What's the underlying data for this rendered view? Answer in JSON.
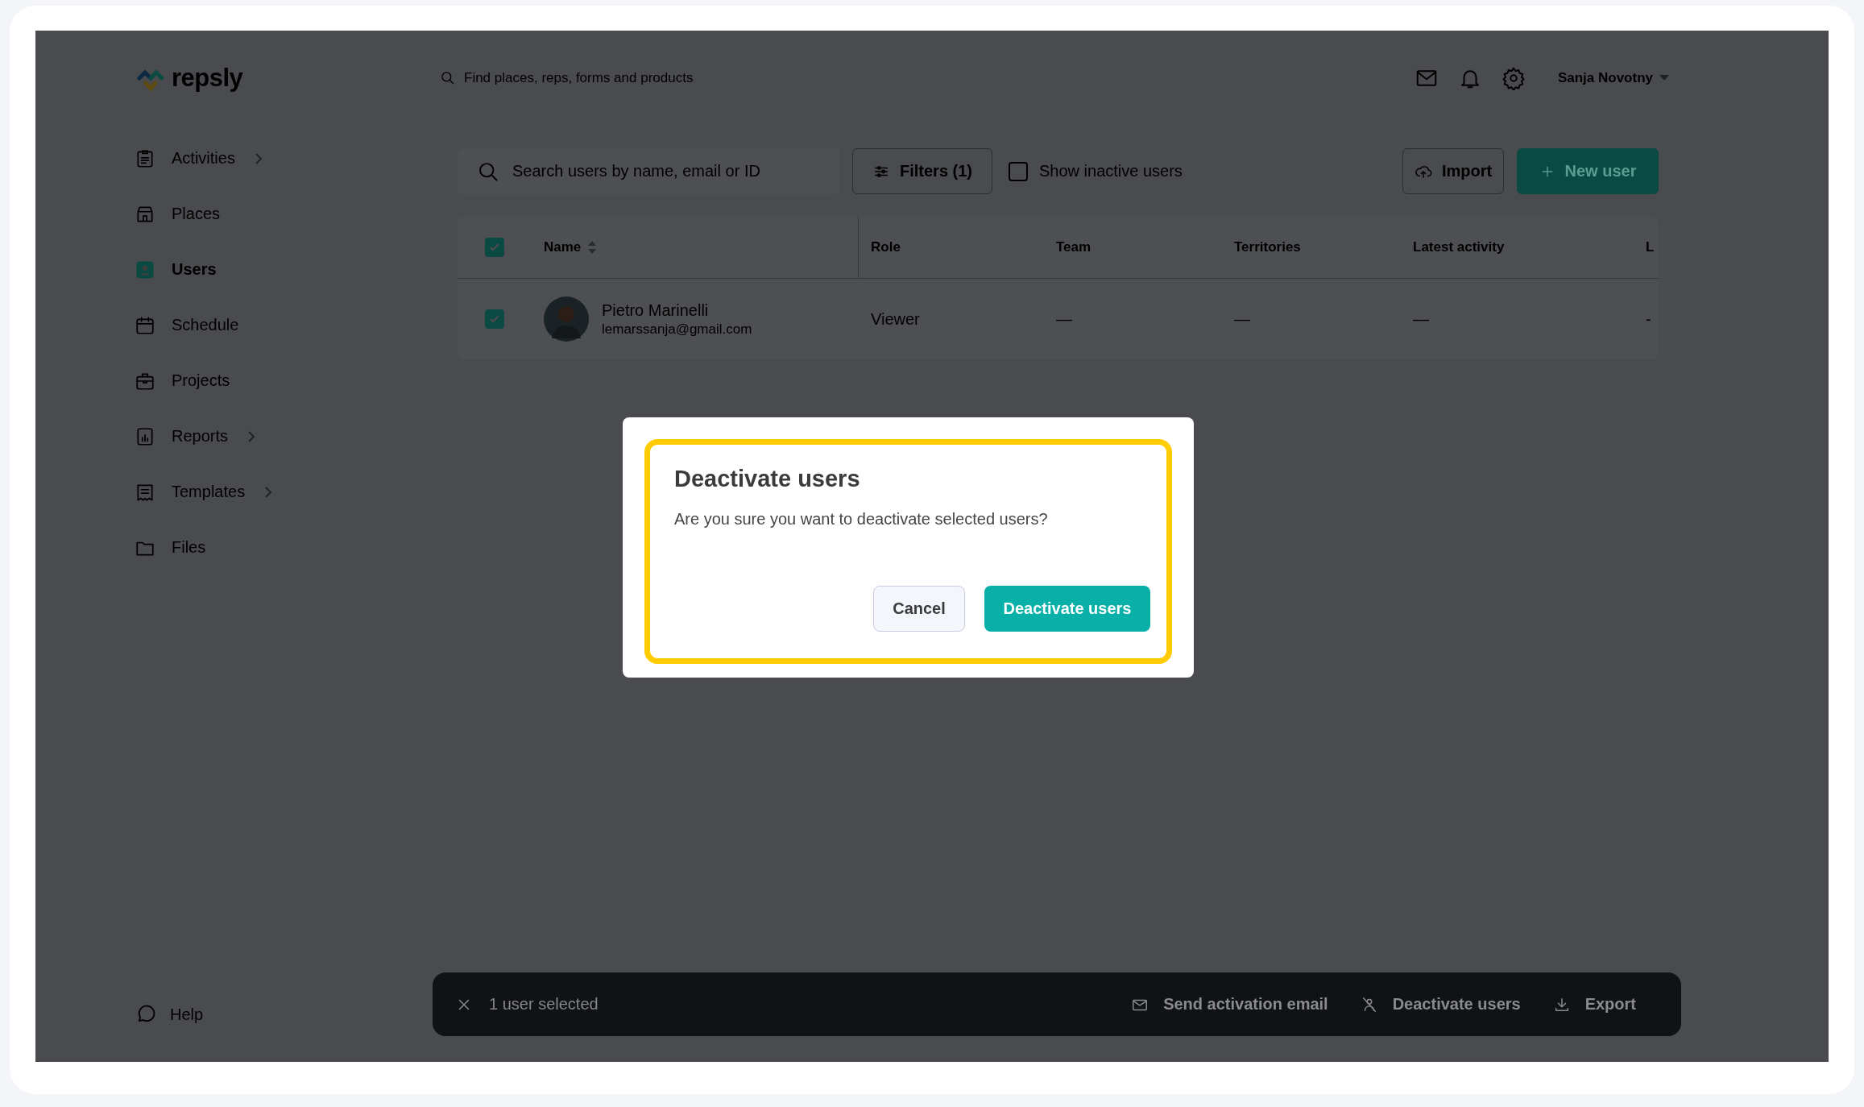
{
  "header": {
    "logo": "repsly",
    "search": {
      "placeholder": "Find places, reps, forms and products"
    },
    "user_menu": "Sanja Novotny"
  },
  "sidebar": {
    "items": [
      {
        "label": "Activities",
        "kind": "clipboard",
        "has_submenu": true,
        "selected": false
      },
      {
        "label": "Places",
        "kind": "store",
        "has_submenu": false,
        "selected": false
      },
      {
        "label": "Users",
        "kind": "user",
        "has_submenu": false,
        "selected": true
      },
      {
        "label": "Schedule",
        "kind": "calendar",
        "has_submenu": false,
        "selected": false
      },
      {
        "label": "Projects",
        "kind": "briefcase",
        "has_submenu": false,
        "selected": false
      },
      {
        "label": "Reports",
        "kind": "chart",
        "has_submenu": true,
        "selected": false
      },
      {
        "label": "Templates",
        "kind": "template",
        "has_submenu": true,
        "selected": false
      },
      {
        "label": "Files",
        "kind": "folder",
        "has_submenu": false,
        "selected": false
      }
    ],
    "help": "Help"
  },
  "toolbar": {
    "search": {
      "placeholder": "Search users by name, email or ID"
    },
    "filters": "Filters (1)",
    "show_inactive": {
      "label": "Show inactive users",
      "checked": false
    },
    "import": "Import",
    "new_user": "New user"
  },
  "table": {
    "select_all": {
      "checked": true
    },
    "columns": [
      "Name",
      "Role",
      "Team",
      "Territories",
      "Latest activity",
      "L"
    ],
    "rows": [
      {
        "selected": true,
        "name": "Pietro Marinelli",
        "email": "lemarssanja@gmail.com",
        "role": "Viewer",
        "team": "—",
        "territories": "—",
        "latest_activity": "—",
        "column_6": "-"
      }
    ]
  },
  "selection_bar": {
    "count": "1 user selected",
    "actions": [
      {
        "kind": "mail",
        "label": "Send activation email"
      },
      {
        "kind": "user-off",
        "label": "Deactivate users"
      },
      {
        "kind": "download",
        "label": "Export"
      }
    ]
  },
  "dialog": {
    "title": "Deactivate users",
    "message": "Are you sure you want to deactivate selected users?",
    "highlighted": true,
    "buttons": [
      {
        "kind": "secondary",
        "label": "Cancel"
      },
      {
        "kind": "primary",
        "label": "Deactivate users"
      }
    ]
  }
}
